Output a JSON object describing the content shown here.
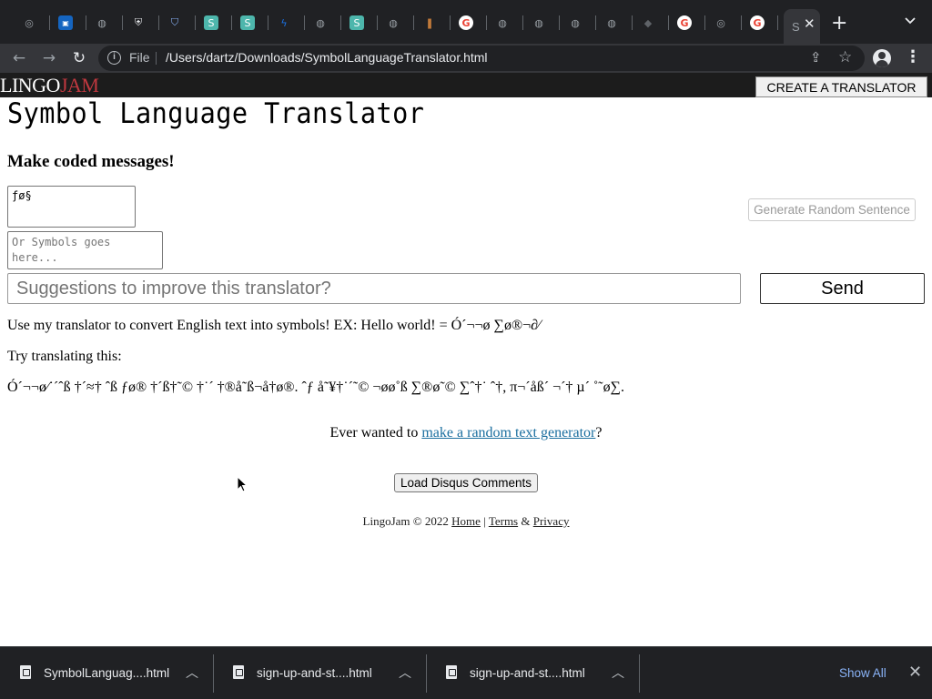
{
  "browser": {
    "tabs": [
      {
        "icon": "chrome-icon",
        "color": "#9aa0a6"
      },
      {
        "icon": "vmware-icon",
        "color": "#1565c0"
      },
      {
        "icon": "globe-icon",
        "color": "#9aa0a6"
      },
      {
        "icon": "lock-shield-icon",
        "color": "#e8eaed"
      },
      {
        "icon": "shield-icon",
        "color": "#8ab4f8"
      },
      {
        "icon": "s-app-icon",
        "color": "#4db6ac"
      },
      {
        "icon": "s-app-icon",
        "color": "#4db6ac"
      },
      {
        "icon": "bolt-icon",
        "color": "#1a73e8"
      },
      {
        "icon": "people-icon",
        "color": "#9aa0a6"
      },
      {
        "icon": "s-app-icon",
        "color": "#4db6ac"
      },
      {
        "icon": "globe-icon",
        "color": "#9aa0a6"
      },
      {
        "icon": "bookmark-icon",
        "color": "#c17a3a"
      },
      {
        "icon": "google-icon",
        "color": "#ea4335"
      },
      {
        "icon": "globe-icon",
        "color": "#9aa0a6"
      },
      {
        "icon": "globe-icon",
        "color": "#9aa0a6"
      },
      {
        "icon": "globe-icon",
        "color": "#9aa0a6"
      },
      {
        "icon": "globe-icon",
        "color": "#9aa0a6"
      },
      {
        "icon": "cube-icon",
        "color": "#5f6368"
      },
      {
        "icon": "google-icon",
        "color": "#ea4335"
      },
      {
        "icon": "chrome-icon",
        "color": "#9aa0a6"
      },
      {
        "icon": "google-icon",
        "color": "#ea4335"
      }
    ],
    "active_tab_label": "S",
    "address": {
      "scheme_label": "File",
      "url": "/Users/dartz/Downloads/SymbolLanguageTranslator.html"
    }
  },
  "site": {
    "logo_part1": "LINGO",
    "logo_part2": "JAM",
    "create_button": "CREATE A TRANSLATOR"
  },
  "page": {
    "title": "Symbol Language Translator",
    "subtitle": "Make coded messages!",
    "input_value": "ƒø§",
    "output_placeholder": "Or Symbols goes here...",
    "generate_button": "Generate Random Sentence",
    "suggest_placeholder": "Suggestions to improve this translator?",
    "send_button": "Send",
    "description": "Use my translator to convert English text into symbols! EX: Hello world! = Ó´¬¬ø ∑ø®¬∂⁄",
    "try_label": "Try translating this:",
    "sample_symbols": "Ó´¬¬ø⁄˙´ˆß †´≈† ˆß ƒø® †´ß†˜© †˙´ †®å˜ß¬å†ø®. ˆƒ å˜¥†˙´˜© ¬øø˚ß ∑®ø˜© ∑ˆ†˙ ˆ†, π¬´åß´ ¬´† µ´ ˚˜ø∑.",
    "generator_prefix": "Ever wanted to ",
    "generator_link": "make a random text generator",
    "generator_suffix": "?",
    "disqus_button": "Load Disqus Comments",
    "footer_text": "LingoJam © 2022",
    "footer_home": "Home",
    "footer_pipe": "|",
    "footer_terms": "Terms",
    "footer_amp": "&",
    "footer_privacy": "Privacy"
  },
  "downloads": {
    "items": [
      {
        "name": "SymbolLanguag....html"
      },
      {
        "name": "sign-up-and-st....html"
      },
      {
        "name": "sign-up-and-st....html"
      }
    ],
    "show_all": "Show All"
  }
}
